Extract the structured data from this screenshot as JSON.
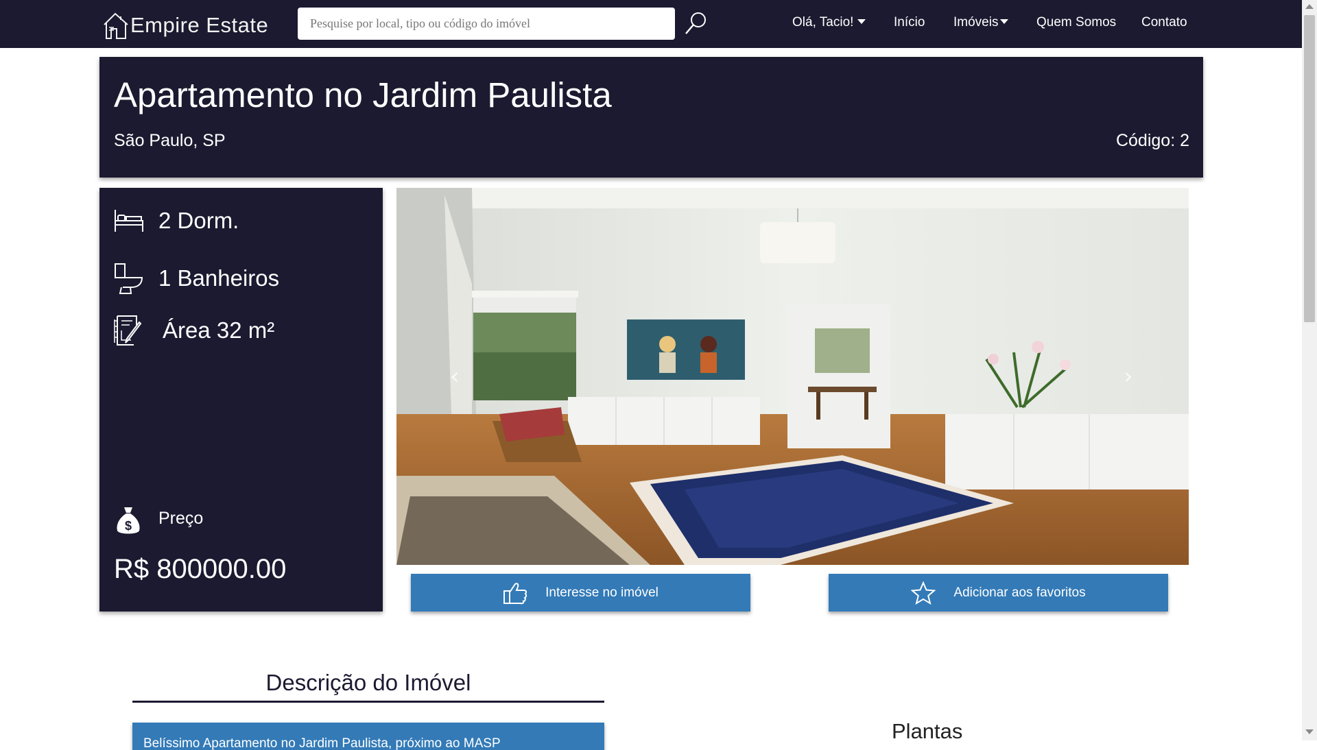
{
  "navbar": {
    "brand": "Empire Estate",
    "logo_icon": "house-outline-icon",
    "search_placeholder": "Pesquise por local, tipo ou código do imóvel",
    "search_icon": "magnifier-icon",
    "links": {
      "user": "Olá, Tacio!",
      "home": "Início",
      "imoveis": "Imóveis",
      "about": "Quem Somos",
      "contact": "Contato"
    }
  },
  "property": {
    "title": "Apartamento no Jardim Paulista",
    "location": "São Paulo, SP",
    "code": "Código: 2",
    "features": {
      "bedrooms": "2 Dorm.",
      "bathrooms": "1 Banheiros",
      "area": "Área 32 m²"
    },
    "price_label": "Preço",
    "price": "R$ 800000.00"
  },
  "carousel": {
    "prev": "‹",
    "next": "›",
    "image_description": "living-room-photo"
  },
  "actions": {
    "interest": "Interesse no imóvel",
    "favorite": "Adicionar aos favoritos"
  },
  "description": {
    "title": "Descrição do Imóvel",
    "text": "Belíssimo Apartamento no Jardim Paulista, próximo ao MASP"
  },
  "plans": {
    "title": "Plantas"
  },
  "colors": {
    "navy": "#1c1a30",
    "button_blue": "#337ab7"
  }
}
